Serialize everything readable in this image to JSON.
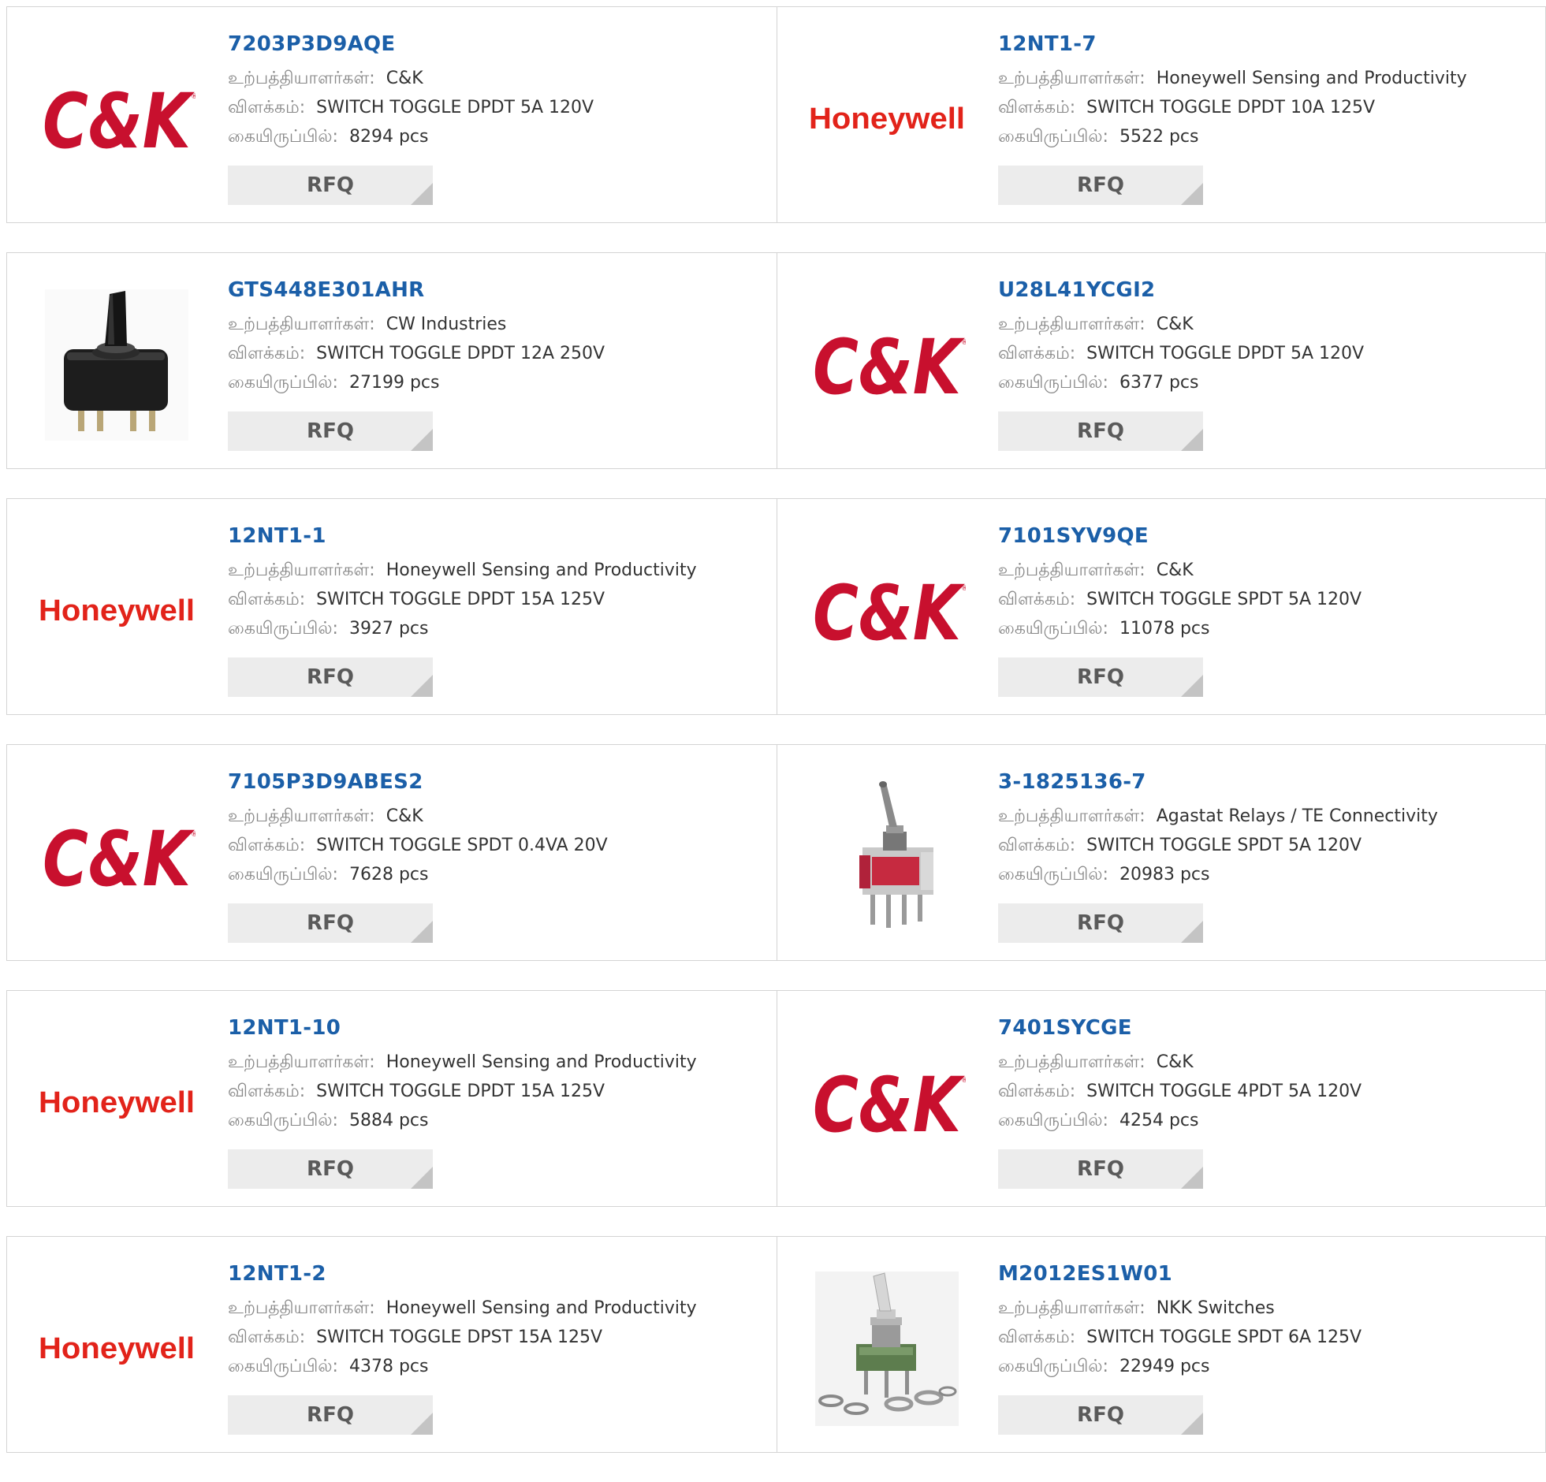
{
  "labels": {
    "manufacturer": "உற்பத்தியாளர்கள்:",
    "description": "விளக்கம்:",
    "stock": "கையிருப்பில்:",
    "rfq": "RFQ"
  },
  "colors": {
    "part_link": "#1b5fa8",
    "ck_logo": "#c8102e",
    "honeywell_logo": "#e2231a",
    "rfq_bg": "#ececec"
  },
  "products": [
    {
      "part": "7203P3D9AQE",
      "manufacturer": "C&K",
      "description": "SWITCH TOGGLE DPDT 5A 120V",
      "stock": "8294 pcs",
      "image": "ck-logo",
      "logo_text": "C&K"
    },
    {
      "part": "12NT1-7",
      "manufacturer": "Honeywell Sensing and Productivity",
      "description": "SWITCH TOGGLE DPDT 10A 125V",
      "stock": "5522 pcs",
      "image": "honeywell-logo",
      "logo_text": "Honeywell"
    },
    {
      "part": "GTS448E301AHR",
      "manufacturer": "CW Industries",
      "description": "SWITCH TOGGLE DPDT 12A 250V",
      "stock": "27199 pcs",
      "image": "black-toggle-switch"
    },
    {
      "part": "U28L41YCGI2",
      "manufacturer": "C&K",
      "description": "SWITCH TOGGLE DPDT 5A 120V",
      "stock": "6377 pcs",
      "image": "ck-logo",
      "logo_text": "C&K"
    },
    {
      "part": "12NT1-1",
      "manufacturer": "Honeywell Sensing and Productivity",
      "description": "SWITCH TOGGLE DPDT 15A 125V",
      "stock": "3927 pcs",
      "image": "honeywell-logo",
      "logo_text": "Honeywell"
    },
    {
      "part": "7101SYV9QE",
      "manufacturer": "C&K",
      "description": "SWITCH TOGGLE SPDT 5A 120V",
      "stock": "11078 pcs",
      "image": "ck-logo",
      "logo_text": "C&K"
    },
    {
      "part": "7105P3D9ABES2",
      "manufacturer": "C&K",
      "description": "SWITCH TOGGLE SPDT 0.4VA 20V",
      "stock": "7628 pcs",
      "image": "ck-logo",
      "logo_text": "C&K"
    },
    {
      "part": "3-1825136-7",
      "manufacturer": "Agastat Relays / TE Connectivity",
      "description": "SWITCH TOGGLE SPDT 5A 120V",
      "stock": "20983 pcs",
      "image": "mini-toggle-switch"
    },
    {
      "part": "12NT1-10",
      "manufacturer": "Honeywell Sensing and Productivity",
      "description": "SWITCH TOGGLE DPDT 15A 125V",
      "stock": "5884 pcs",
      "image": "honeywell-logo",
      "logo_text": "Honeywell"
    },
    {
      "part": "7401SYCGE",
      "manufacturer": "C&K",
      "description": "SWITCH TOGGLE 4PDT 5A 120V",
      "stock": "4254 pcs",
      "image": "ck-logo",
      "logo_text": "C&K"
    },
    {
      "part": "12NT1-2",
      "manufacturer": "Honeywell Sensing and Productivity",
      "description": "SWITCH TOGGLE DPST 15A 125V",
      "stock": "4378 pcs",
      "image": "honeywell-logo",
      "logo_text": "Honeywell"
    },
    {
      "part": "M2012ES1W01",
      "manufacturer": "NKK Switches",
      "description": "SWITCH TOGGLE SPDT 6A 125V",
      "stock": "22949 pcs",
      "image": "nkk-toggle-switch"
    }
  ]
}
